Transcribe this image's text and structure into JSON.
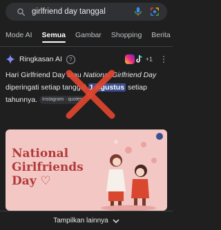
{
  "search": {
    "query": "girlfriend day tanggal",
    "icons": [
      "search-icon",
      "microphone-icon",
      "lens-icon"
    ]
  },
  "tabs": [
    {
      "label": "Mode AI",
      "active": false
    },
    {
      "label": "Semua",
      "active": true
    },
    {
      "label": "Gambar",
      "active": false
    },
    {
      "label": "Shopping",
      "active": false
    },
    {
      "label": "Berita",
      "active": false
    }
  ],
  "ai_overview": {
    "title": "Ringkasan AI",
    "info": "?",
    "sources_more": "+1",
    "menu": "⋮",
    "text_1": "Hari Girlfriend Day atau ",
    "text_italic": "National Girlfriend Day",
    "text_2": " diperingati setiap tanggal ",
    "date_highlight": "1 Agustus",
    "text_3": " setiap tahunnya.",
    "source_chip": "Instagram · quotes",
    "image_caption": "National Girlfriends Day ♡"
  },
  "footer": {
    "show_more": "Tampilkan lainnya"
  },
  "colors": {
    "background": "#1f1f1f",
    "highlight": "#3b4e8f",
    "card": "#f3c7c3",
    "red_x": "#e0452f"
  }
}
